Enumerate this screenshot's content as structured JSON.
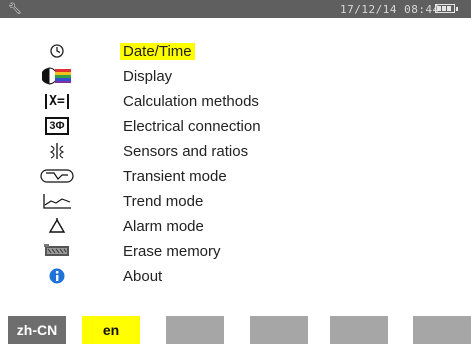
{
  "status": {
    "datetime": "17/12/14 08:44",
    "battery_icon": "battery-icon"
  },
  "menu": {
    "items": [
      {
        "label": "Date/Time",
        "icon": "clock-icon",
        "selected": true
      },
      {
        "label": "Display",
        "icon": "display-icon",
        "selected": false
      },
      {
        "label": "Calculation methods",
        "icon": "calculation-icon",
        "selected": false
      },
      {
        "label": "Electrical connection",
        "icon": "connection-icon",
        "selected": false
      },
      {
        "label": "Sensors and ratios",
        "icon": "sensor-icon",
        "selected": false
      },
      {
        "label": "Transient mode",
        "icon": "transient-icon",
        "selected": false
      },
      {
        "label": "Trend mode",
        "icon": "trend-icon",
        "selected": false
      },
      {
        "label": "Alarm mode",
        "icon": "alarm-icon",
        "selected": false
      },
      {
        "label": "Erase memory",
        "icon": "erase-icon",
        "selected": false
      },
      {
        "label": "About",
        "icon": "info-icon",
        "selected": false
      }
    ],
    "calc_icon_text": "X=",
    "connection_icon_text": "3Φ"
  },
  "tabs": [
    {
      "label": "zh-CN",
      "state": "dark"
    },
    {
      "label": "en",
      "state": "active"
    },
    {
      "label": "",
      "state": "normal"
    },
    {
      "label": "",
      "state": "normal"
    },
    {
      "label": "",
      "state": "normal"
    },
    {
      "label": "",
      "state": "normal"
    },
    {
      "label": "",
      "state": "normal"
    }
  ],
  "colors": {
    "statusbar": "#5f5f5f",
    "selection": "#ffff00",
    "tab": "#a6a6a6",
    "tab_dark": "#6e6e6e",
    "info": "#1e73d8"
  }
}
